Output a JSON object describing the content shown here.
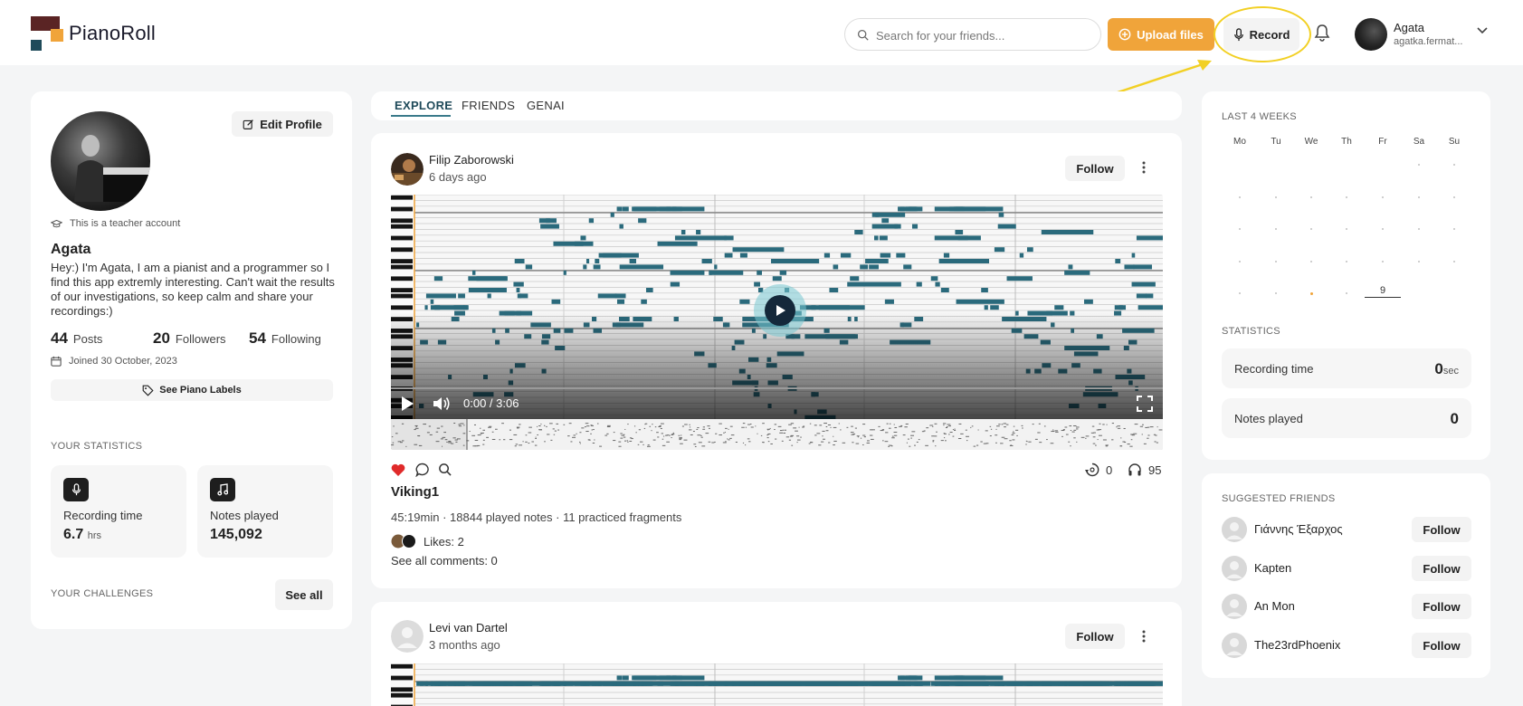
{
  "header": {
    "brand": "PianoRoll",
    "search_placeholder": "Search for your friends...",
    "upload_label": "Upload files",
    "record_label": "Record",
    "user": {
      "name": "Agata",
      "handle": "agatka.fermat..."
    }
  },
  "profile": {
    "edit_label": "Edit Profile",
    "teacher_note": "This is a teacher account",
    "name": "Agata",
    "bio": "Hey:) I'm Agata, I am a pianist and a programmer so I find this app extremly interesting. Can't wait the results of our investigations, so keep calm and share your recordings:)",
    "posts_count": "44",
    "posts_label": "Posts",
    "followers_count": "20",
    "followers_label": "Followers",
    "following_count": "54",
    "following_label": "Following",
    "joined": "Joined 30 October, 2023",
    "labels_button": "See Piano Labels",
    "stats_title": "YOUR STATISTICS",
    "recording_label": "Recording time",
    "recording_value": "6.7",
    "recording_unit": "hrs",
    "notes_label": "Notes played",
    "notes_value": "145,092",
    "challenges_title": "YOUR CHALLENGES",
    "see_all": "See all"
  },
  "tabs": [
    "EXPLORE",
    "FRIENDS",
    "GENAI"
  ],
  "post1": {
    "author": "Filip Zaborowski",
    "time": "6 days ago",
    "follow": "Follow",
    "video_time": "0:00 / 3:06",
    "reposts": "0",
    "listens": "95",
    "title": "Viking1",
    "meta": "45:19min · 18844 played notes · 11 practiced fragments",
    "likes": "Likes: 2",
    "comments": "See all comments: 0"
  },
  "post2": {
    "author": "Levi van Dartel",
    "time": "3 months ago",
    "follow": "Follow"
  },
  "calendar": {
    "title": "LAST 4 WEEKS",
    "weekdays": [
      "Mo",
      "Tu",
      "We",
      "Th",
      "Fr",
      "Sa",
      "Su"
    ],
    "today": "9",
    "stats_title": "STATISTICS",
    "recording_label": "Recording time",
    "recording_value": "0",
    "recording_unit": "sec",
    "notes_label": "Notes played",
    "notes_value": "0"
  },
  "suggested": {
    "title": "SUGGESTED FRIENDS",
    "follow": "Follow",
    "friends": [
      "Γιάννης Έξαρχος",
      "Kapten",
      "An Mon",
      "The23rdPhoenix"
    ]
  },
  "colors": {
    "accent": "#f0a43a",
    "note": "#2a6a7c",
    "highlight_ring": "#f2d024",
    "like": "#e02a2a"
  }
}
